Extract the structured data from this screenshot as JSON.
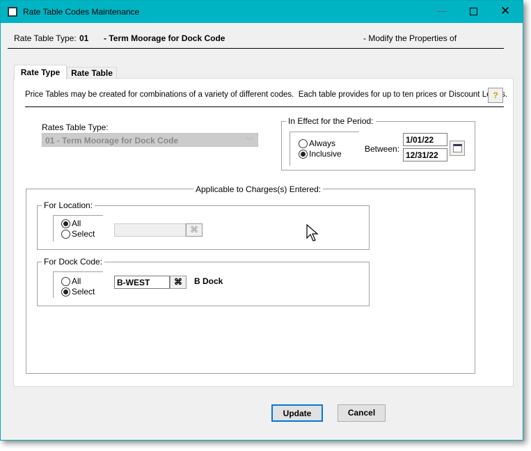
{
  "window": {
    "title": "Rate Table Codes Maintenance"
  },
  "header": {
    "type_label": "Rate Table Type:",
    "type_code": "01",
    "type_desc": "- Term Moorage for Dock Code",
    "mode_text": "- Modify the Properties of"
  },
  "tabs": [
    {
      "label": "Rate Type",
      "active": true
    },
    {
      "label": "Rate Table",
      "active": false
    }
  ],
  "description": "Price Tables may be created for combinations of a variety of different codes.  Each table provides for up to ten prices or Discount Levels.",
  "rates_table_type": {
    "label": "Rates Table Type:",
    "value": "01 - Term Moorage for Dock Code",
    "disabled": true
  },
  "period": {
    "title": "In Effect for the Period:",
    "options": [
      "Always",
      "Inclusive"
    ],
    "selected": "Inclusive",
    "between_label": "Between:",
    "start": "1/01/22",
    "end": "12/31/22"
  },
  "applicable": {
    "title": "Applicable to Charges(s) Entered:",
    "location": {
      "title": "For Location:",
      "options": [
        "All",
        "Select"
      ],
      "selected": "All",
      "value": ""
    },
    "dock": {
      "title": "For Dock Code:",
      "options": [
        "All",
        "Select"
      ],
      "selected": "Select",
      "value": "B-WEST",
      "desc": "B Dock"
    }
  },
  "buttons": {
    "update": "Update",
    "cancel": "Cancel"
  },
  "colors": {
    "titlebar": "#00b4c4",
    "dialog_bg": "#f0f0f0"
  }
}
